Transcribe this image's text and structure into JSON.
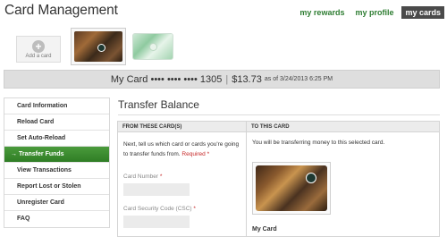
{
  "page": {
    "title": "Card Management"
  },
  "top_nav": [
    {
      "label": "my rewards",
      "active": false
    },
    {
      "label": "my profile",
      "active": false
    },
    {
      "label": "my cards",
      "active": true
    }
  ],
  "card_strip": {
    "add_label": "Add a card",
    "add_icon": "plus-icon"
  },
  "balance": {
    "card_name": "My Card •••• •••• •••• 1305",
    "separator": "|",
    "amount": "$13.73",
    "as_of": "as of 3/24/2013 6:25 PM"
  },
  "sidebar": {
    "items": [
      {
        "label": "Card Information"
      },
      {
        "label": "Reload Card"
      },
      {
        "label": "Set Auto-Reload"
      },
      {
        "label": "Transfer Funds",
        "active": true
      },
      {
        "label": "View Transactions"
      },
      {
        "label": "Report Lost or Stolen"
      },
      {
        "label": "Unregister Card"
      },
      {
        "label": "FAQ"
      }
    ],
    "active_arrow": "→"
  },
  "main": {
    "title": "Transfer Balance",
    "from_header": "FROM THESE CARD(S)",
    "to_header": "TO THIS CARD",
    "from_text": "Next, tell us which card or cards you're going to transfer funds from.",
    "required_text": "Required *",
    "card_number_label": "Card Number",
    "csc_label": "Card Security Code (CSC)",
    "required_star": "*",
    "to_text": "You will be transferring money to this selected card.",
    "to_card_label": "My Card"
  },
  "colors": {
    "accent_green": "#2e7d32",
    "active_nav_bg": "#4a4a4a",
    "sidebar_active": "#3a8c2e"
  }
}
